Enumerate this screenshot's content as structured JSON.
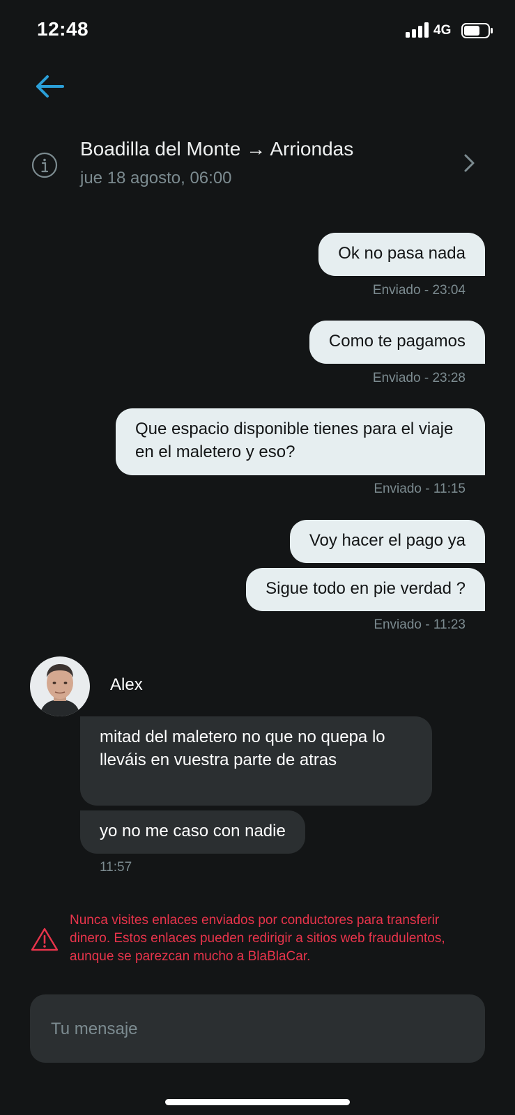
{
  "status_bar": {
    "time": "12:48",
    "network": "4G"
  },
  "trip": {
    "route": "Boadilla del Monte → Arriondas",
    "date": "jue 18 agosto, 06:00"
  },
  "messages_sent": [
    {
      "text": "Ok no pasa nada",
      "stamp": "Enviado - 23:04"
    },
    {
      "text": "Como te pagamos",
      "stamp": "Enviado - 23:28"
    },
    {
      "text": "Que espacio disponible tienes para el viaje en el maletero y eso?",
      "stamp": "Enviado - 11:15"
    },
    {
      "text": "Voy hacer el pago ya"
    },
    {
      "text": "Sigue todo en pie verdad ?",
      "stamp": "Enviado - 11:23"
    }
  ],
  "messages_received": {
    "sender": "Alex",
    "items": [
      {
        "text": "mitad del maletero no que no quepa lo lleváis en vuestra parte de atras"
      },
      {
        "text": "yo no me caso con nadie"
      }
    ],
    "time": "11:57"
  },
  "warning": "Nunca visites enlaces enviados por conductores para transferir dinero. Estos enlaces pueden redirigir a sitios web fraudulentos, aunque se parezcan mucho a BlaBlaCar.",
  "composer": {
    "placeholder": "Tu mensaje",
    "value": ""
  },
  "colors": {
    "background": "#131516",
    "accent": "#2b9fd8",
    "outgoing_bubble": "#e6eef0",
    "incoming_bubble": "#2b2f31",
    "muted": "#7c8b90",
    "warning": "#e8344b"
  },
  "icons": [
    "signal-icon",
    "battery-icon",
    "back-arrow-icon",
    "info-icon",
    "chevron-right-icon",
    "warning-icon"
  ]
}
